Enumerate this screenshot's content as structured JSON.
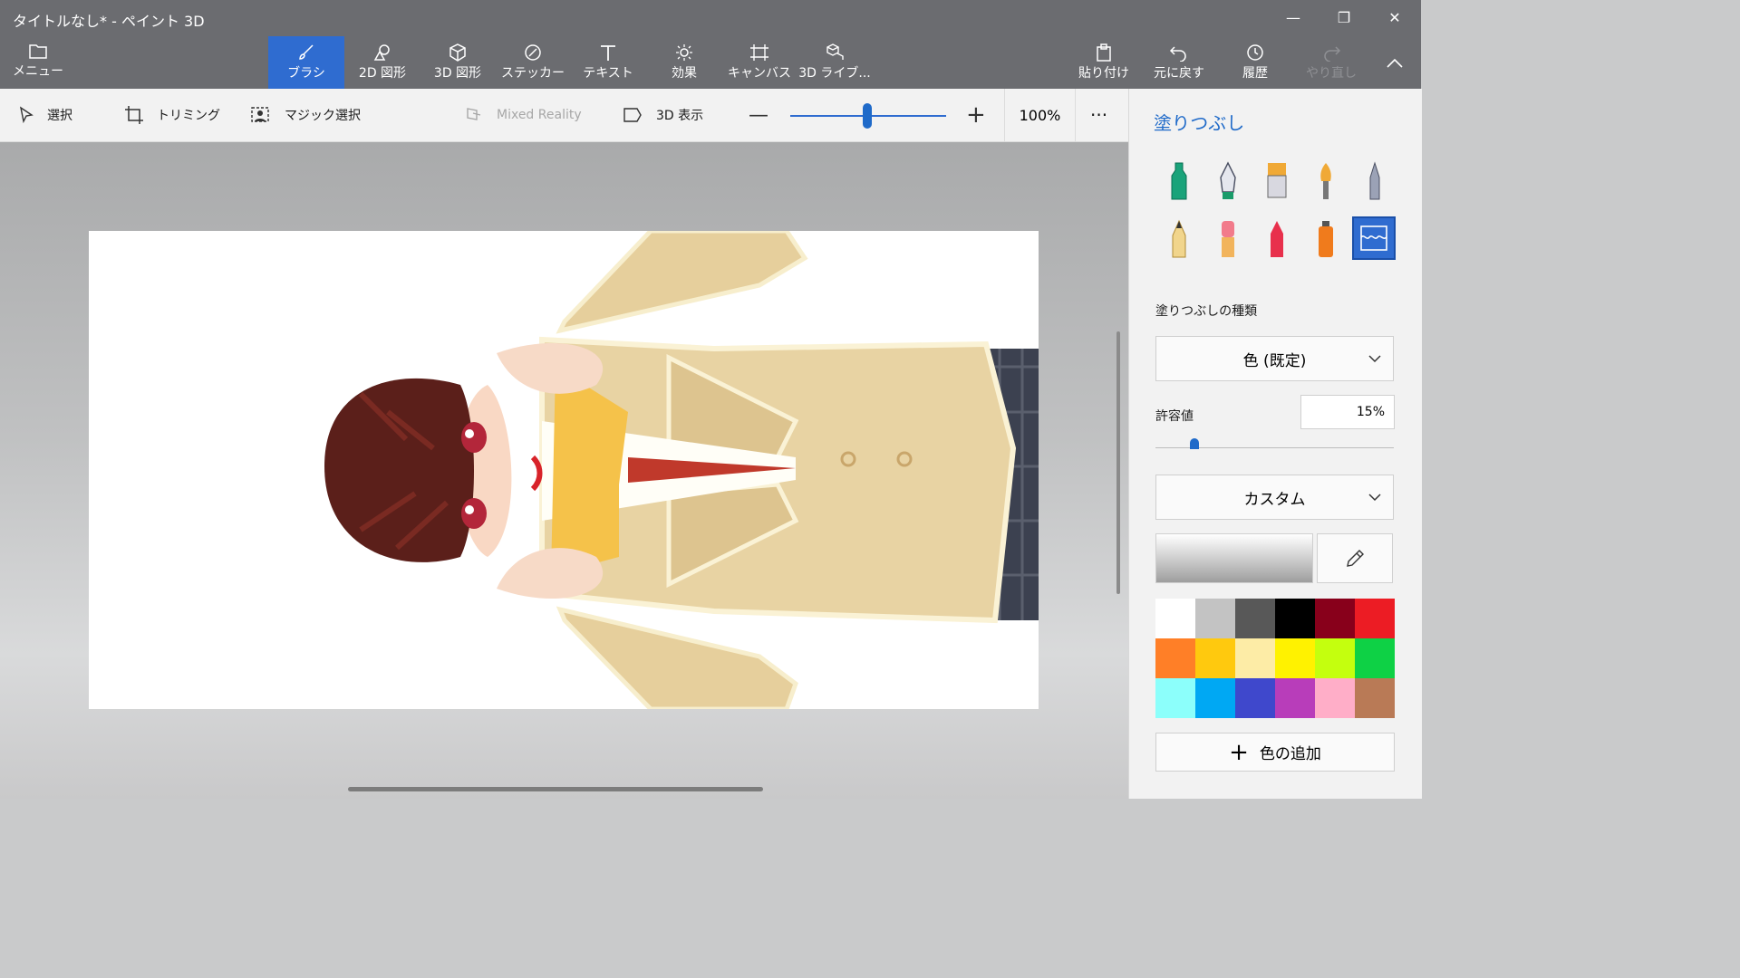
{
  "window": {
    "title": "タイトルなし* - ペイント 3D"
  },
  "menu": {
    "label": "メニュー"
  },
  "tools": [
    {
      "label": "ブラシ",
      "icon": "brush-icon"
    },
    {
      "label": "2D 図形",
      "icon": "2d-shapes-icon"
    },
    {
      "label": "3D 図形",
      "icon": "3d-shapes-icon"
    },
    {
      "label": "ステッカー",
      "icon": "sticker-icon"
    },
    {
      "label": "テキスト",
      "icon": "text-icon"
    },
    {
      "label": "効果",
      "icon": "effects-icon"
    },
    {
      "label": "キャンバス",
      "icon": "canvas-icon"
    },
    {
      "label": "3D ライブ...",
      "icon": "3d-library-icon"
    }
  ],
  "actions": {
    "paste": "貼り付け",
    "undo": "元に戻す",
    "history": "履歴",
    "redo": "やり直し"
  },
  "toolbar": {
    "select": "選択",
    "crop": "トリミング",
    "magic_select": "マジック選択",
    "mixed_reality": "Mixed Reality",
    "view_3d": "3D 表示",
    "zoom_percent": "100%",
    "more": "···"
  },
  "panel": {
    "title": "塗りつぶし",
    "fill_type_label": "塗りつぶしの種類",
    "fill_type_value": "色 (既定)",
    "tolerance_label": "許容値",
    "tolerance_value": "15%",
    "color_mode_value": "カスタム",
    "add_color": "色の追加"
  },
  "palette": [
    "#ffffff",
    "#c3c3c3",
    "#585858",
    "#000000",
    "#88001b",
    "#ec1c24",
    "#ff7f27",
    "#ffc90e",
    "#fdeca6",
    "#fff200",
    "#c4ff0e",
    "#0ed145",
    "#8cfffb",
    "#00a8f3",
    "#3f48cc",
    "#b83dba",
    "#ffaec8",
    "#b97a56"
  ],
  "colors": {
    "accent": "#2f6cd0",
    "titlebar": "#6b6c70"
  }
}
